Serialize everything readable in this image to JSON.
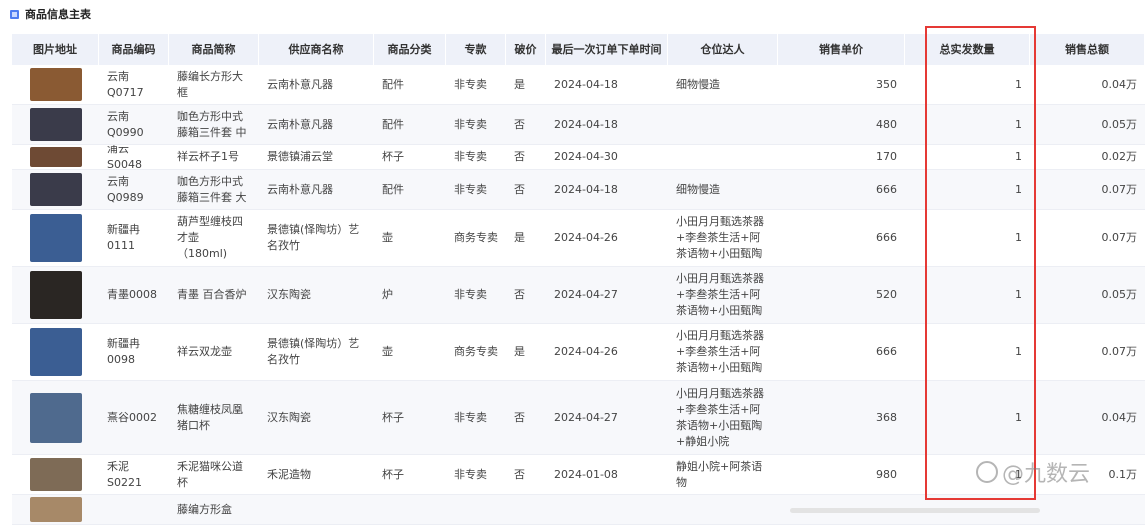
{
  "title": "商品信息主表",
  "columns": [
    "图片地址",
    "商品编码",
    "商品简称",
    "供应商名称",
    "商品分类",
    "专款",
    "破价",
    "最后一次订单下单时间",
    "仓位达人",
    "销售单价",
    "总实发数量",
    "销售总额"
  ],
  "rows": [
    {
      "image": "rattan-frame",
      "code": "云南Q0717",
      "name": "藤编长方形大框",
      "supplier": "云南朴意凡器",
      "category": "配件",
      "special": "非专卖",
      "broken": "是",
      "last_order": "2024-04-18",
      "talent": "细物慢造",
      "price": "350",
      "qty": "1",
      "total": "0.04万"
    },
    {
      "image": "brown-rattan-box",
      "code": "云南Q0990",
      "name": "咖色方形中式藤箱三件套 中",
      "supplier": "云南朴意凡器",
      "category": "配件",
      "special": "非专卖",
      "broken": "否",
      "last_order": "2024-04-18",
      "talent": "",
      "price": "480",
      "qty": "1",
      "total": "0.05万"
    },
    {
      "image": "cup",
      "code": "浦云S0048",
      "name": "祥云杯子1号",
      "supplier": "景德镇浦云堂",
      "category": "杯子",
      "special": "非专卖",
      "broken": "否",
      "last_order": "2024-04-30",
      "talent": "",
      "price": "170",
      "qty": "1",
      "total": "0.02万"
    },
    {
      "image": "brown-rattan-box",
      "code": "云南Q0989",
      "name": "咖色方形中式藤箱三件套 大",
      "supplier": "云南朴意凡器",
      "category": "配件",
      "special": "非专卖",
      "broken": "否",
      "last_order": "2024-04-18",
      "talent": "细物慢造",
      "price": "666",
      "qty": "1",
      "total": "0.07万"
    },
    {
      "image": "blue-teapot",
      "code": "新疆冉0111",
      "name": "葫芦型缠枝四才壶 （180ml)",
      "supplier": "景德镇(怿陶坊）艺名孜竹",
      "category": "壶",
      "special": "商务专卖",
      "broken": "是",
      "last_order": "2024-04-26",
      "talent": "小田月月甄选茶器+李叁茶生活+阿茶语物+小田甄陶",
      "price": "666",
      "qty": "1",
      "total": "0.07万"
    },
    {
      "image": "incense-burner",
      "code": "青墨0008",
      "name": "青墨 百合香炉",
      "supplier": "汉东陶瓷",
      "category": "炉",
      "special": "非专卖",
      "broken": "否",
      "last_order": "2024-04-27",
      "talent": "小田月月甄选茶器+李叁茶生活+阿茶语物+小田甄陶",
      "price": "520",
      "qty": "1",
      "total": "0.05万"
    },
    {
      "image": "blue-teapot",
      "code": "新疆冉0098",
      "name": "祥云双龙壶",
      "supplier": "景德镇(怿陶坊）艺名孜竹",
      "category": "壶",
      "special": "商务专卖",
      "broken": "是",
      "last_order": "2024-04-26",
      "talent": "小田月月甄选茶器+李叁茶生活+阿茶语物+小田甄陶",
      "price": "666",
      "qty": "1",
      "total": "0.07万"
    },
    {
      "image": "coffee-cup",
      "code": "熹谷0002",
      "name": "焦糖缠枝凤凰猪口杯",
      "supplier": "汉东陶瓷",
      "category": "杯子",
      "special": "非专卖",
      "broken": "否",
      "last_order": "2024-04-27",
      "talent": "小田月月甄选茶器+李叁茶生活+阿茶语物+小田甄陶+静姐小院",
      "price": "368",
      "qty": "1",
      "total": "0.04万"
    },
    {
      "image": "cat-cup",
      "code": "禾泥S0221",
      "name": "禾泥猫咪公道杯",
      "supplier": "禾泥造物",
      "category": "杯子",
      "special": "非专卖",
      "broken": "否",
      "last_order": "2024-01-08",
      "talent": "静姐小院+阿茶语物",
      "price": "980",
      "qty": "1",
      "total": "0.1万"
    },
    {
      "image": "partial",
      "code": "",
      "name": "藤编方形盒",
      "supplier": "",
      "category": "",
      "special": "",
      "broken": "",
      "last_order": "",
      "talent": "",
      "price": "",
      "qty": "",
      "total": ""
    }
  ],
  "image_colors": {
    "rattan-frame": "#8a5a33",
    "brown-rattan-box": "#3a3b4a",
    "cup": "#6e4a34",
    "blue-teapot": "#3b5e93",
    "incense-burner": "#2a2623",
    "coffee-cup": "#4f6a8e",
    "cat-cup": "#7e6b56",
    "partial": "#a78968"
  },
  "highlight_color": "#e53935",
  "watermark": "@九数云"
}
